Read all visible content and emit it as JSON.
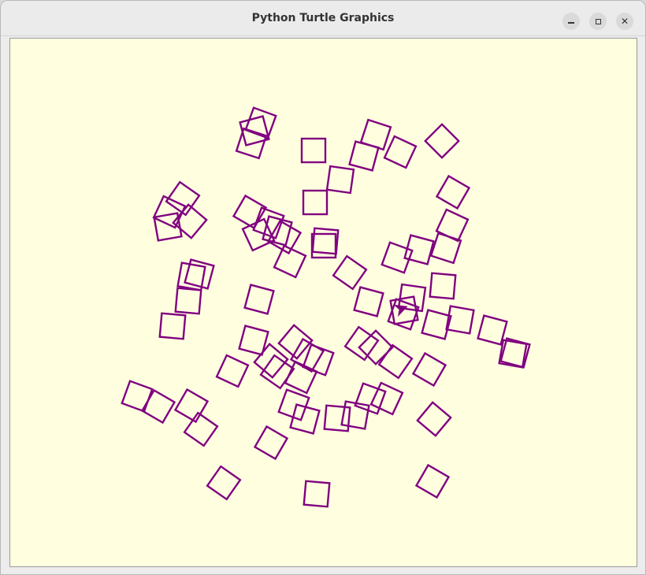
{
  "window": {
    "title": "Python Turtle Graphics",
    "buttons": {
      "minimize": "minimize-icon",
      "maximize": "maximize-icon",
      "close": "close-icon"
    }
  },
  "canvas": {
    "background": "#ffffe0",
    "pen_color": "#800080",
    "shape": "square",
    "square_count": 80
  }
}
